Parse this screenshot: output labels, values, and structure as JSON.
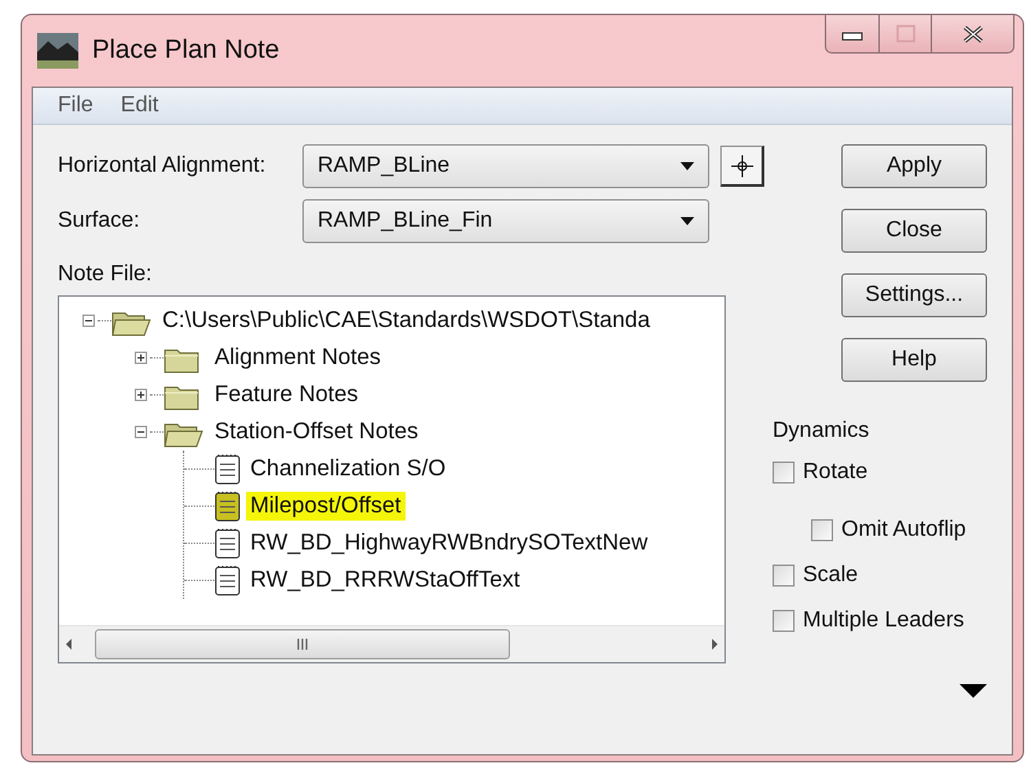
{
  "window": {
    "title": "Place Plan Note",
    "controls": [
      {
        "kind": "minimize",
        "disabled": false
      },
      {
        "kind": "maximize",
        "disabled": true
      },
      {
        "kind": "close",
        "disabled": false
      }
    ]
  },
  "menu": [
    "File",
    "Edit"
  ],
  "horizontal_alignment": {
    "label": "Horizontal Alignment:",
    "value": "RAMP_BLine"
  },
  "surface": {
    "label": "Surface:",
    "value": "RAMP_BLine_Fin"
  },
  "note_file": {
    "label": "Note File:",
    "tree": [
      {
        "label": "C:\\Users\\Public\\CAE\\Standards\\WSDOT\\Standa",
        "kind": "folder",
        "expanded": true,
        "selected": false,
        "children": [
          {
            "label": "Alignment Notes",
            "kind": "folder",
            "expanded": false,
            "selected": false
          },
          {
            "label": "Feature Notes",
            "kind": "folder",
            "expanded": false,
            "selected": false
          },
          {
            "label": "Station-Offset Notes",
            "kind": "folder",
            "expanded": true,
            "selected": false,
            "children": [
              {
                "label": "Channelization S/O",
                "kind": "file",
                "selected": false
              },
              {
                "label": "Milepost/Offset",
                "kind": "file",
                "selected": true
              },
              {
                "label": "RW_BD_HighwayRWBndrySOTextNew",
                "kind": "file",
                "selected": false
              },
              {
                "label": "RW_BD_RRRWStaOffText",
                "kind": "file",
                "selected": false
              }
            ]
          }
        ]
      }
    ]
  },
  "buttons": [
    "Apply",
    "Close",
    "Settings...",
    "Help"
  ],
  "dynamics": {
    "label": "Dynamics",
    "options": [
      {
        "label": "Rotate",
        "checked": false,
        "children": [
          {
            "label": "Omit Autoflip",
            "checked": false
          }
        ]
      },
      {
        "label": "Scale",
        "checked": false
      },
      {
        "label": "Multiple Leaders",
        "checked": false
      }
    ]
  }
}
